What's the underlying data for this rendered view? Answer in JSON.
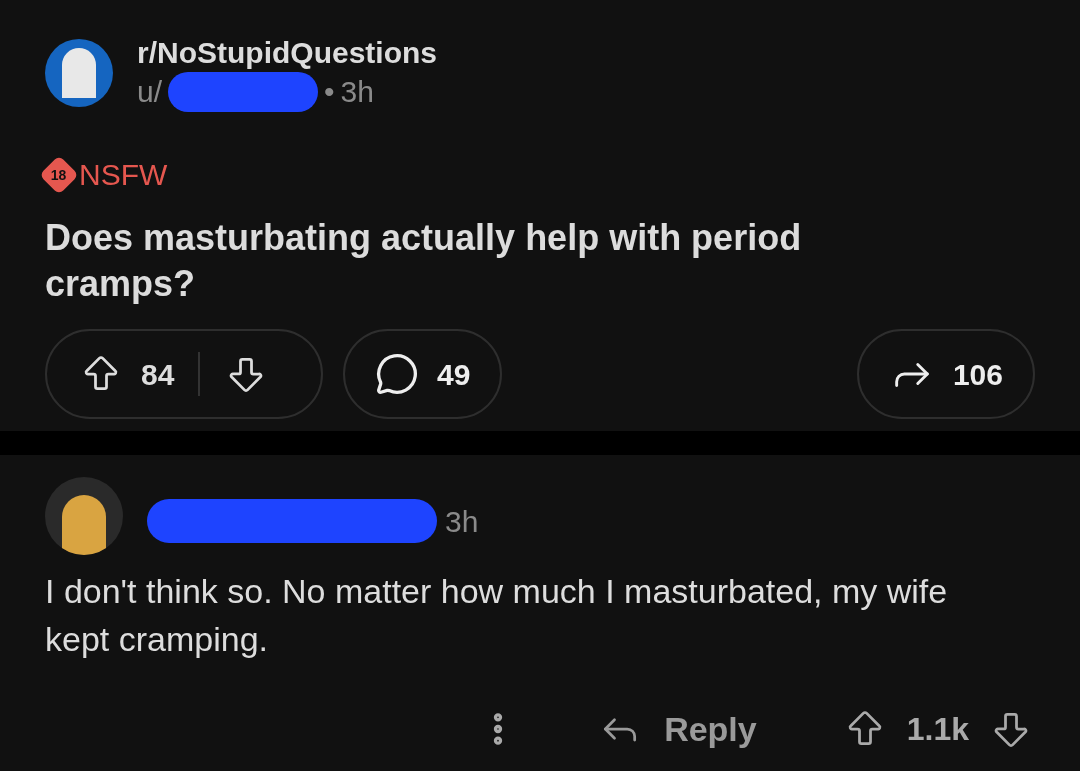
{
  "post": {
    "subreddit": "r/NoStupidQuestions",
    "author_prefix": "u/",
    "separator": "•",
    "time": "3h",
    "nsfw_badge": "18",
    "nsfw_label": "NSFW",
    "title": "Does masturbating actually help with period cramps?",
    "upvotes": "84",
    "comments": "49",
    "shares": "106"
  },
  "comment": {
    "time": "3h",
    "body": "I don't think so. No matter how much I masturbated, my wife kept cramping.",
    "reply_label": "Reply",
    "score": "1.1k"
  }
}
